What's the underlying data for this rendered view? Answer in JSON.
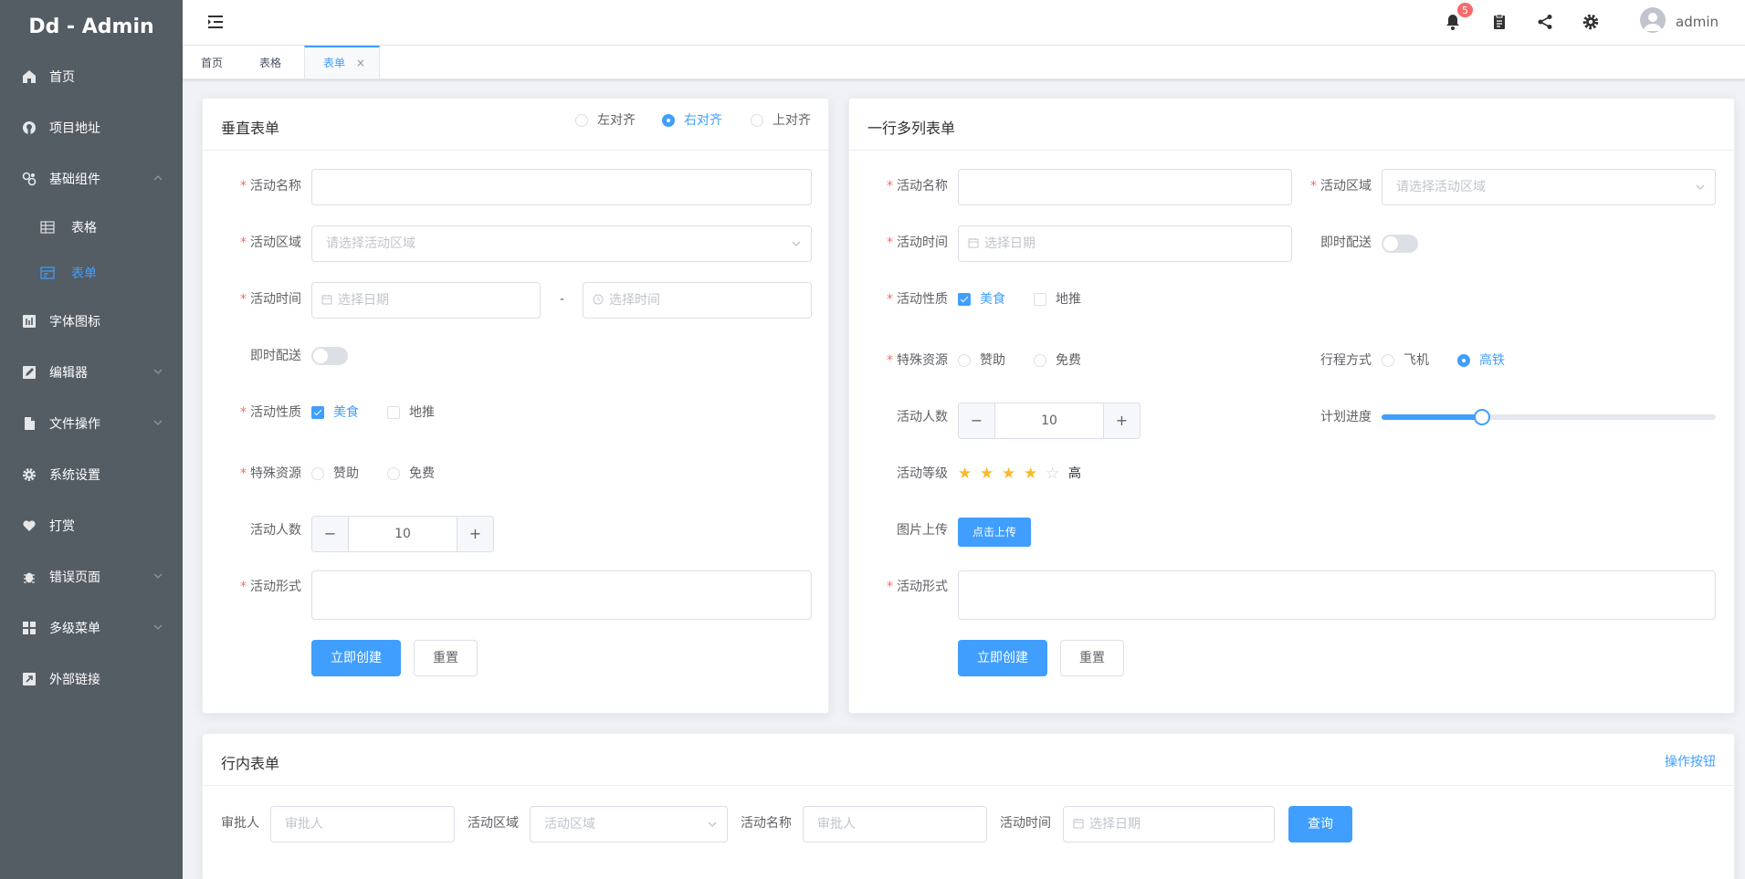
{
  "app": {
    "title": "Dd - Admin"
  },
  "sidebar": {
    "items": [
      {
        "label": "首页",
        "icon": "home-icon"
      },
      {
        "label": "项目地址",
        "icon": "github-icon"
      },
      {
        "label": "基础组件",
        "icon": "components-icon",
        "expanded": true,
        "children": [
          {
            "label": "表格",
            "icon": "table-icon"
          },
          {
            "label": "表单",
            "icon": "form-icon",
            "active": true
          }
        ]
      },
      {
        "label": "字体图标",
        "icon": "font-icon"
      },
      {
        "label": "编辑器",
        "icon": "editor-icon",
        "has_children": true
      },
      {
        "label": "文件操作",
        "icon": "file-icon",
        "has_children": true
      },
      {
        "label": "系统设置",
        "icon": "gear-icon"
      },
      {
        "label": "打赏",
        "icon": "heart-icon"
      },
      {
        "label": "错误页面",
        "icon": "bug-icon",
        "has_children": true
      },
      {
        "label": "多级菜单",
        "icon": "grid-icon",
        "has_children": true
      },
      {
        "label": "外部链接",
        "icon": "external-link-icon"
      }
    ],
    "active_color": "#409eff",
    "bg_color": "#545c64"
  },
  "header": {
    "notification_count": "5",
    "username": "admin"
  },
  "tags": [
    {
      "label": "首页"
    },
    {
      "label": "表格"
    },
    {
      "label": "表单",
      "active": true,
      "close": "×"
    }
  ],
  "vertical_form": {
    "title": "垂直表单",
    "align_options": [
      {
        "label": "左对齐",
        "checked": false
      },
      {
        "label": "右对齐",
        "checked": true
      },
      {
        "label": "上对齐",
        "checked": false
      }
    ],
    "name_label": "活动名称",
    "name_value": "",
    "region_label": "活动区域",
    "region_placeholder": "请选择活动区域",
    "time_label": "活动时间",
    "date_placeholder": "选择日期",
    "time_sep": "-",
    "time_placeholder": "选择时间",
    "delivery_label": "即时配送",
    "delivery_on": false,
    "type_label": "活动性质",
    "type_options": [
      {
        "label": "美食",
        "checked": true
      },
      {
        "label": "地推",
        "checked": false
      }
    ],
    "resource_label": "特殊资源",
    "resource_options": [
      {
        "label": "赞助",
        "checked": false
      },
      {
        "label": "免费",
        "checked": false
      }
    ],
    "count_label": "活动人数",
    "count_value": "10",
    "desc_label": "活动形式",
    "submit_label": "立即创建",
    "reset_label": "重置"
  },
  "multi_form": {
    "title": "一行多列表单",
    "name_label": "活动名称",
    "region_label": "活动区域",
    "region_placeholder": "请选择活动区域",
    "time_label": "活动时间",
    "date_placeholder": "选择日期",
    "delivery_label": "即时配送",
    "delivery_on": false,
    "type_label": "活动性质",
    "type_options": [
      {
        "label": "美食",
        "checked": true
      },
      {
        "label": "地推",
        "checked": false
      }
    ],
    "resource_label": "特殊资源",
    "resource_options": [
      {
        "label": "赞助",
        "checked": false
      },
      {
        "label": "免费",
        "checked": false
      }
    ],
    "travel_label": "行程方式",
    "travel_options": [
      {
        "label": "飞机",
        "checked": false
      },
      {
        "label": "高铁",
        "checked": true
      }
    ],
    "count_label": "活动人数",
    "count_value": "10",
    "progress_label": "计划进度",
    "progress_value": 30,
    "level_label": "活动等级",
    "rating_value": 4,
    "rating_max": 5,
    "rating_text": "高",
    "upload_label": "图片上传",
    "upload_button": "点击上传",
    "desc_label": "活动形式",
    "submit_label": "立即创建",
    "reset_label": "重置"
  },
  "inline_form": {
    "title": "行内表单",
    "action_link": "操作按钮",
    "approver_label": "审批人",
    "approver_placeholder": "审批人",
    "region_label": "活动区域",
    "region_placeholder": "活动区域",
    "name_label": "活动名称",
    "name_placeholder": "审批人",
    "time_label": "活动时间",
    "date_placeholder": "选择日期",
    "query_label": "查询"
  }
}
